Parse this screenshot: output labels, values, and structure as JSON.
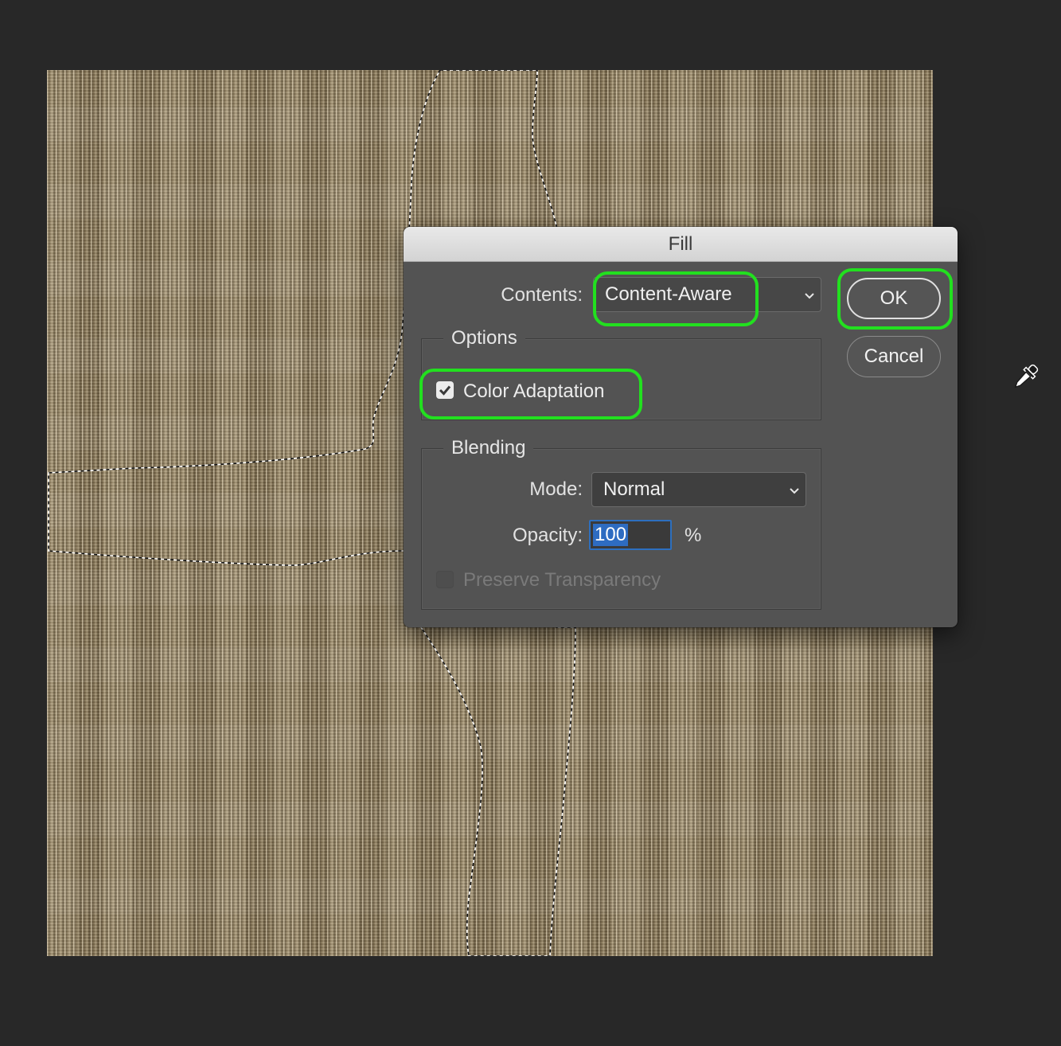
{
  "dialog": {
    "title": "Fill",
    "contents_label": "Contents:",
    "contents_value": "Content-Aware",
    "options_title": "Options",
    "color_adaptation_label": "Color Adaptation",
    "color_adaptation_checked": true,
    "blending_title": "Blending",
    "mode_label": "Mode:",
    "mode_value": "Normal",
    "opacity_label": "Opacity:",
    "opacity_value": "100",
    "opacity_unit": "%",
    "preserve_transparency_label": "Preserve Transparency",
    "preserve_transparency_checked": false,
    "preserve_transparency_enabled": false,
    "ok_label": "OK",
    "cancel_label": "Cancel"
  },
  "colors": {
    "workspace_bg": "#282828",
    "dialog_bg": "#535353",
    "highlight": "#22e01f",
    "selection_blue": "#2e6cc1"
  },
  "icons": {
    "cursor": "eyedropper-icon",
    "dropdown": "chevron-down-icon",
    "checkbox": "checkmark-icon"
  }
}
